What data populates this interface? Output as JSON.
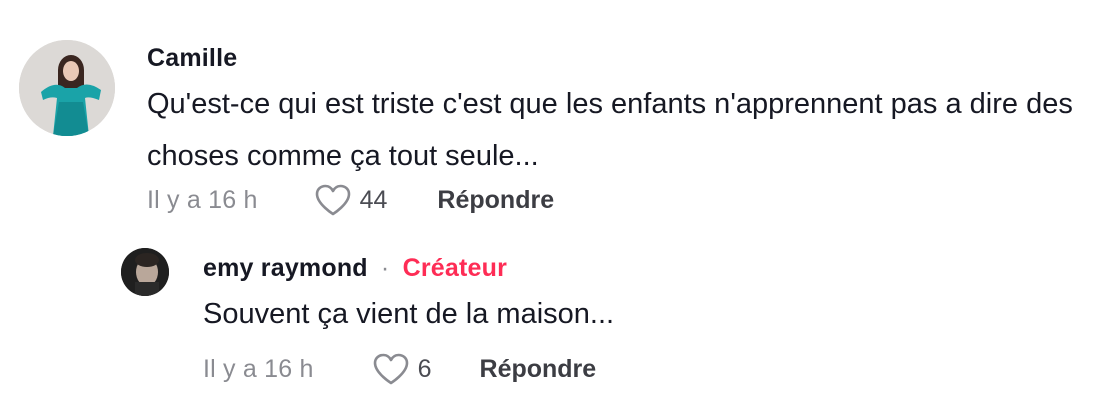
{
  "comments": [
    {
      "username": "Camille",
      "text": "Qu'est-ce qui est triste c'est que les enfants n'apprennent pas a dire des choses comme ça tout seule...",
      "time": "Il y a 16 h",
      "likes": "44",
      "reply_label": "Répondre"
    }
  ],
  "replies": [
    {
      "username": "emy raymond",
      "separator": "·",
      "badge": "Créateur",
      "text": "Souvent ça vient de la maison...",
      "time": "Il y a 16 h",
      "likes": "6",
      "reply_label": "Répondre"
    }
  ],
  "colors": {
    "creator_badge": "#fe2c55",
    "muted": "#8a8b91",
    "text": "#161823"
  },
  "icons": {
    "like": "heart-outline-icon"
  }
}
